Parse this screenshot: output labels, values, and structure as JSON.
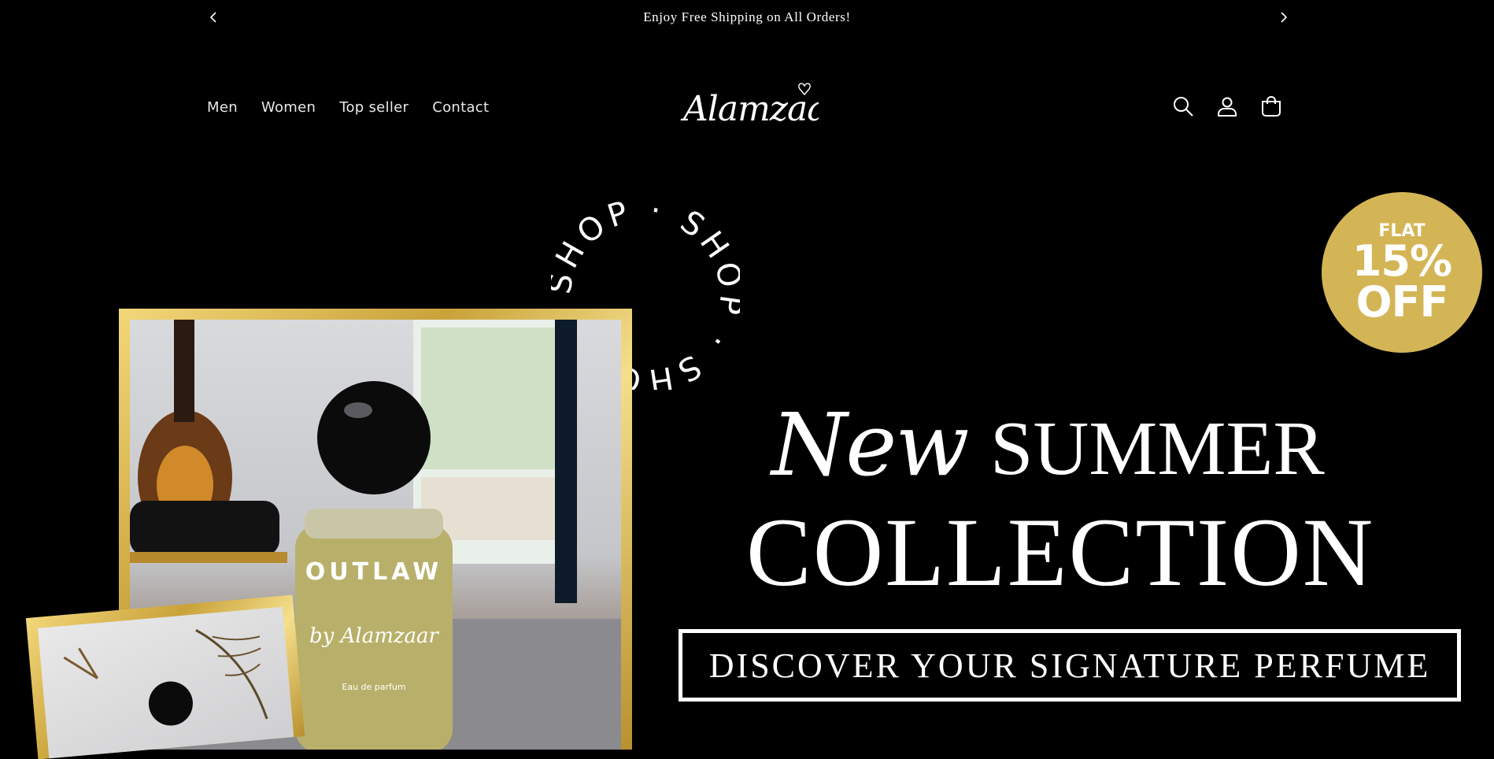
{
  "announcement": {
    "text": "Enjoy Free Shipping on All Orders!",
    "prev_icon": "chevron-left-icon",
    "next_icon": "chevron-right-icon"
  },
  "header": {
    "nav": [
      {
        "label": "Men"
      },
      {
        "label": "Women"
      },
      {
        "label": "Top seller"
      },
      {
        "label": "Contact"
      }
    ],
    "logo_text": "Alamzaar",
    "icons": [
      "search-icon",
      "account-icon",
      "cart-icon"
    ]
  },
  "hero": {
    "ring_text": "SHOP · SHOP · SHOP ·",
    "badge": {
      "line1": "FLAT",
      "line2": "15%",
      "line3": "OFF",
      "color": "#d4b556"
    },
    "headline_script": "New",
    "headline_word": "SUMMER",
    "headline_main": "COLLECTION",
    "cta_label": "DISCOVER YOUR SIGNATURE PERFUME",
    "product": {
      "name": "OUTLAW",
      "sub": "by Alamzaar",
      "small": "Eau de parfum"
    }
  },
  "colors": {
    "background": "#000000",
    "gold": "#d4b556",
    "text": "#ffffff"
  }
}
